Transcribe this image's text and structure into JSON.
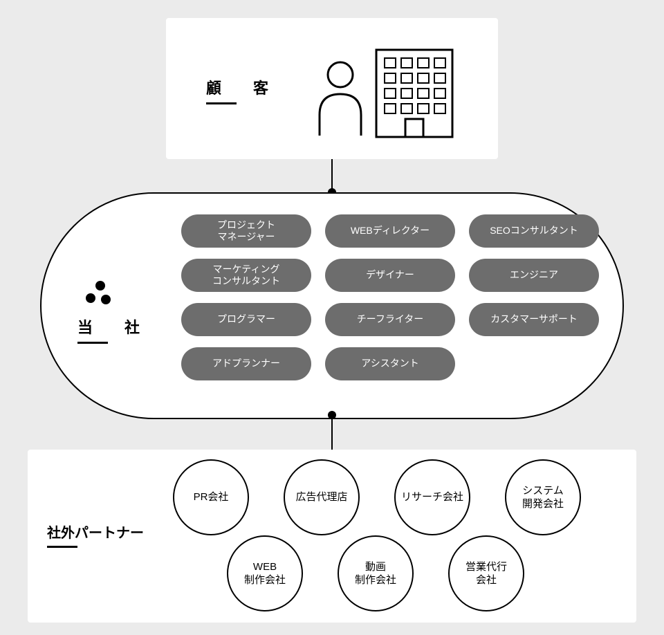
{
  "customer": {
    "label": "顧　客"
  },
  "company": {
    "label": "当　社",
    "roles": [
      "プロジェクト\nマネージャー",
      "WEBディレクター",
      "SEOコンサルタント",
      "マーケティング\nコンサルタント",
      "デザイナー",
      "エンジニア",
      "プログラマー",
      "チーフライター",
      "カスタマーサポート",
      "アドプランナー",
      "アシスタント"
    ]
  },
  "partners": {
    "label": "社外パートナー",
    "items": [
      "PR会社",
      "広告代理店",
      "リサーチ会社",
      "システム\n開発会社",
      "WEB\n制作会社",
      "動画\n制作会社",
      "営業代行\n会社"
    ]
  }
}
